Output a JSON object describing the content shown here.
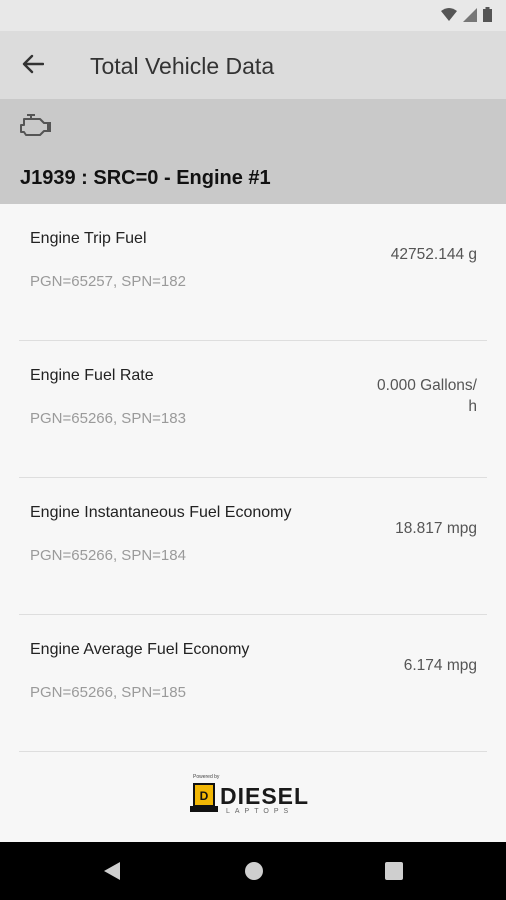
{
  "status_bar": {
    "icons": [
      "wifi-icon",
      "signal-icon",
      "battery-icon"
    ]
  },
  "app_bar": {
    "title": "Total Vehicle Data",
    "back_icon": "arrow-left-icon"
  },
  "engine_header": {
    "icon": "engine-icon",
    "title": "J1939 : SRC=0 - Engine #1"
  },
  "items": [
    {
      "name": "Engine Trip Fuel",
      "meta": "PGN=65257, SPN=182",
      "value": "42752.144 g"
    },
    {
      "name": "Engine Fuel Rate",
      "meta": "PGN=65266, SPN=183",
      "value": "0.000 Gallons/\nh"
    },
    {
      "name": "Engine Instantaneous Fuel Economy",
      "meta": "PGN=65266, SPN=184",
      "value": "18.817 mpg"
    },
    {
      "name": "Engine Average Fuel Economy",
      "meta": "PGN=65266, SPN=185",
      "value": "6.174 mpg"
    }
  ],
  "logo": {
    "powered_by": "Powered by",
    "word": "DIESEL",
    "sub": "LAPTOPS"
  },
  "nav_bar": {
    "icons": [
      "back-triangle-icon",
      "home-circle-icon",
      "recents-square-icon"
    ]
  },
  "colors": {
    "status_bar": "#e8e8e8",
    "app_bar": "#dcdcdc",
    "engine_header": "#c9c9c9",
    "logo_accent": "#f2b705"
  }
}
